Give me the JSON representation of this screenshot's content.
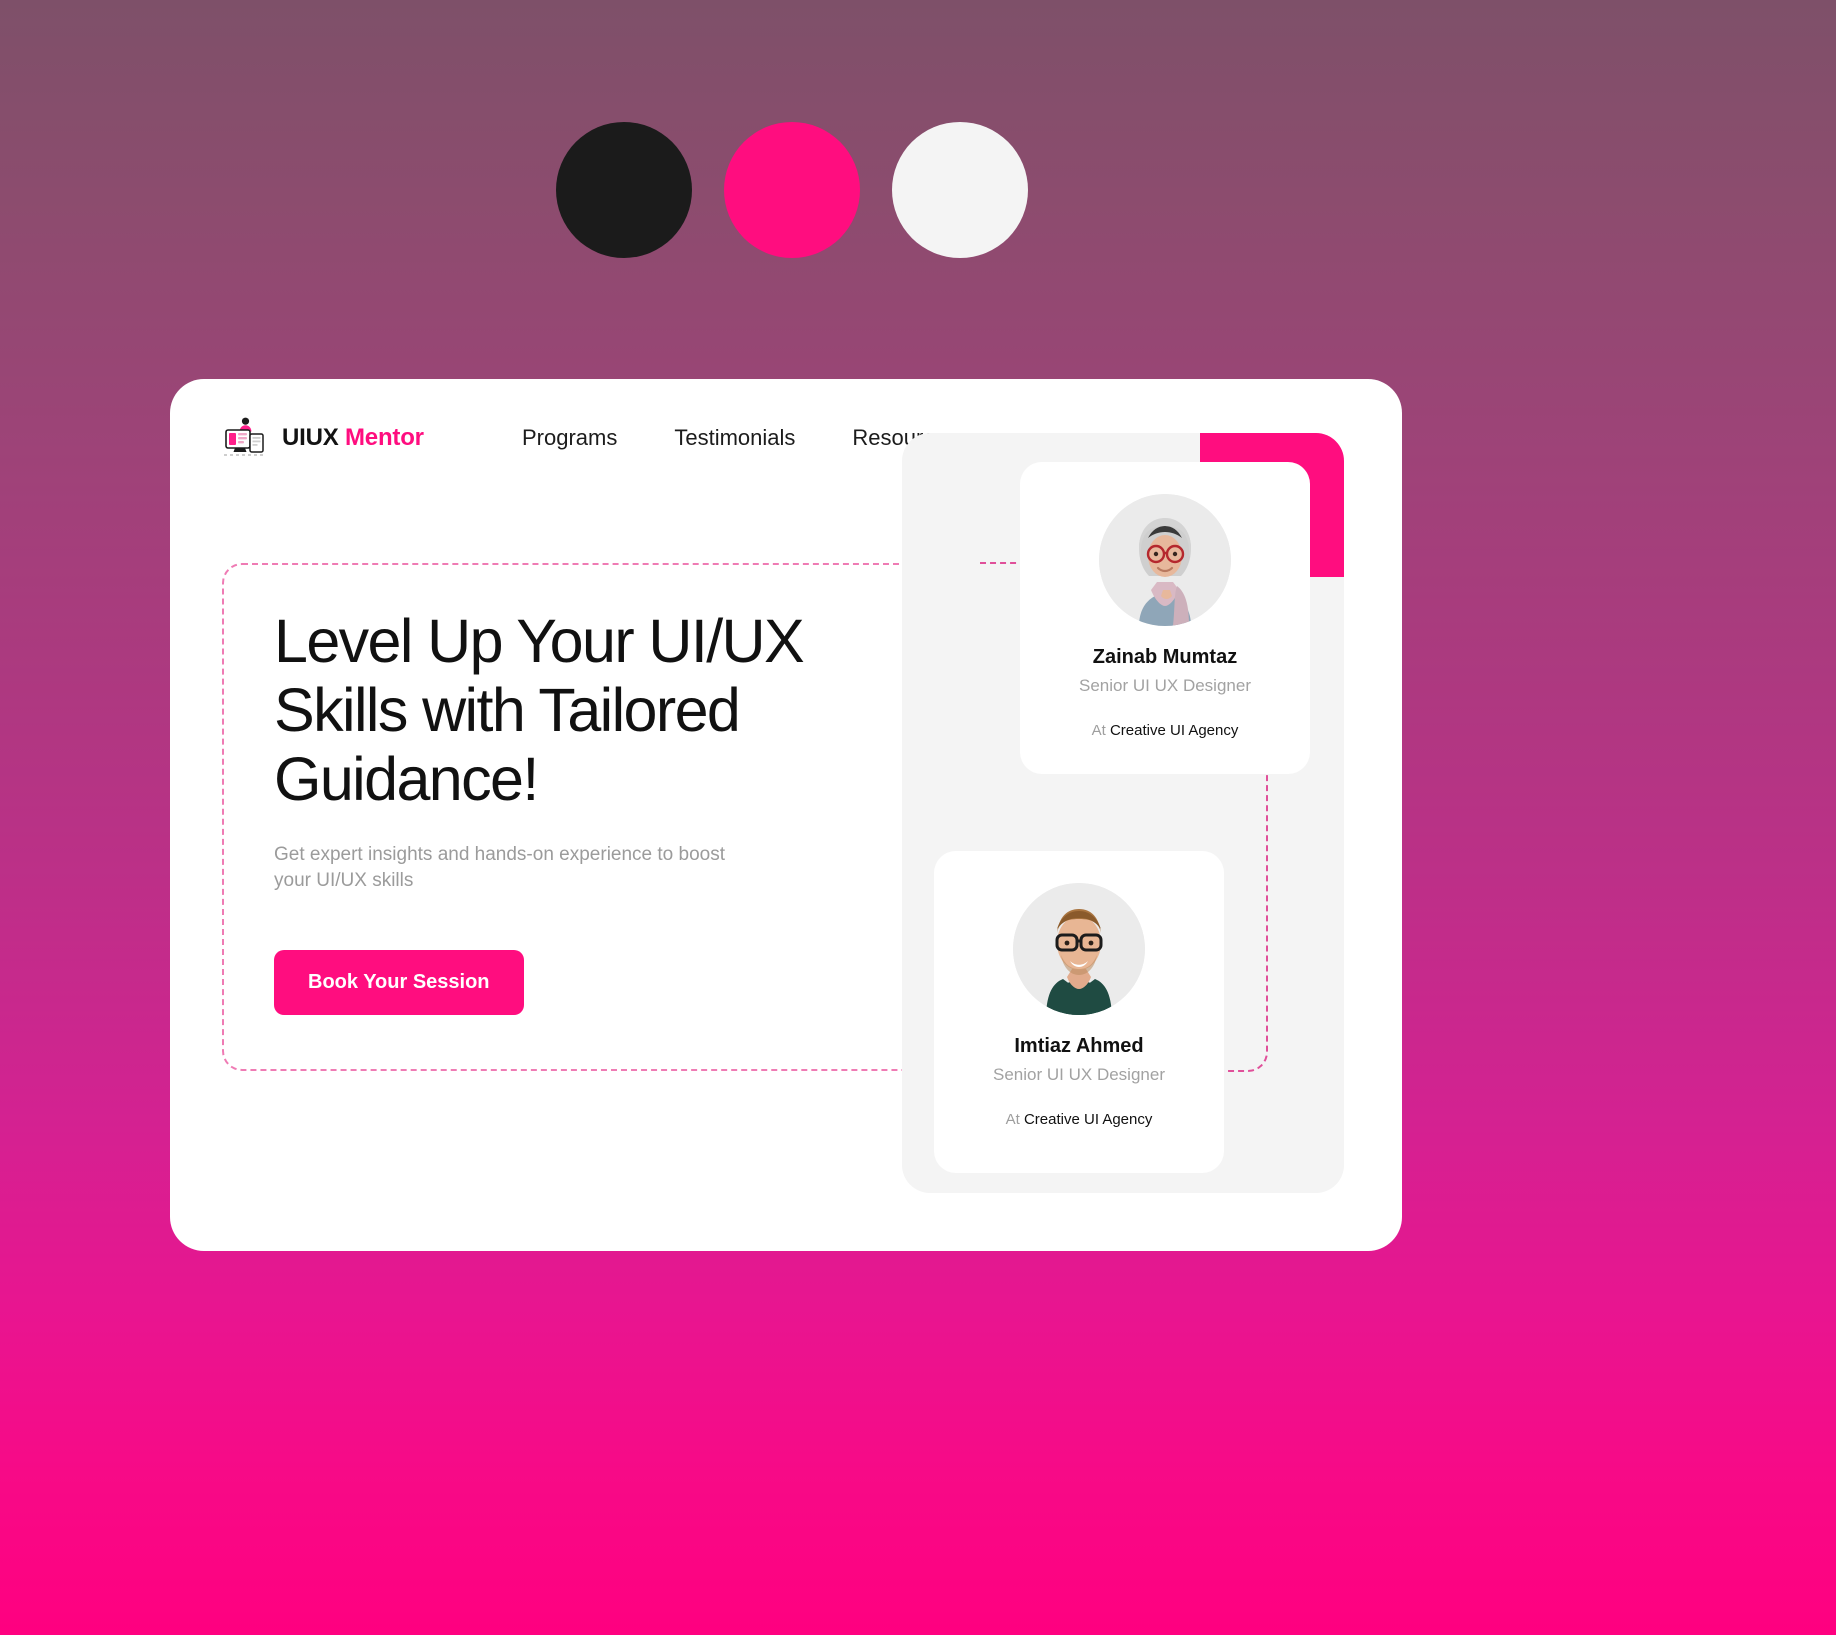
{
  "swatches": [
    {
      "name": "black-swatch",
      "color": "#1b1b1b"
    },
    {
      "name": "pink-swatch",
      "color": "#ff0d7f"
    },
    {
      "name": "white-swatch",
      "color": "#f4f4f4"
    }
  ],
  "brand": {
    "name_primary": "UIUX",
    "name_accent": "Mentor",
    "icon": "workstation-illustration-icon"
  },
  "nav": {
    "items": [
      {
        "label": "Programs"
      },
      {
        "label": "Testimonials"
      },
      {
        "label": "Resources"
      }
    ]
  },
  "hero": {
    "title": "Level Up Your UI/UX Skills with Tailored Guidance!",
    "subtitle": "Get expert insights and hands-on experience to boost your UI/UX skills",
    "cta_label": "Book Your Session"
  },
  "mentors": [
    {
      "name": "Zainab Mumtaz",
      "role": "Senior UI UX Designer",
      "at_label": "At",
      "company": "Creative UI Agency",
      "avatar": "woman-hijab-glasses-avatar"
    },
    {
      "name": "Imtiaz Ahmed",
      "role": "Senior UI UX Designer",
      "at_label": "At",
      "company": "Creative UI Agency",
      "avatar": "man-glasses-beard-avatar"
    }
  ],
  "colors": {
    "accent_pink": "#ff0d7f",
    "ink": "#111111",
    "muted": "#9b9b9b",
    "panel_grey": "#f4f4f4",
    "dashed_pink": "#ef7bb4",
    "bg_top": "#7e5069",
    "bg_bottom": "#ff0080"
  }
}
